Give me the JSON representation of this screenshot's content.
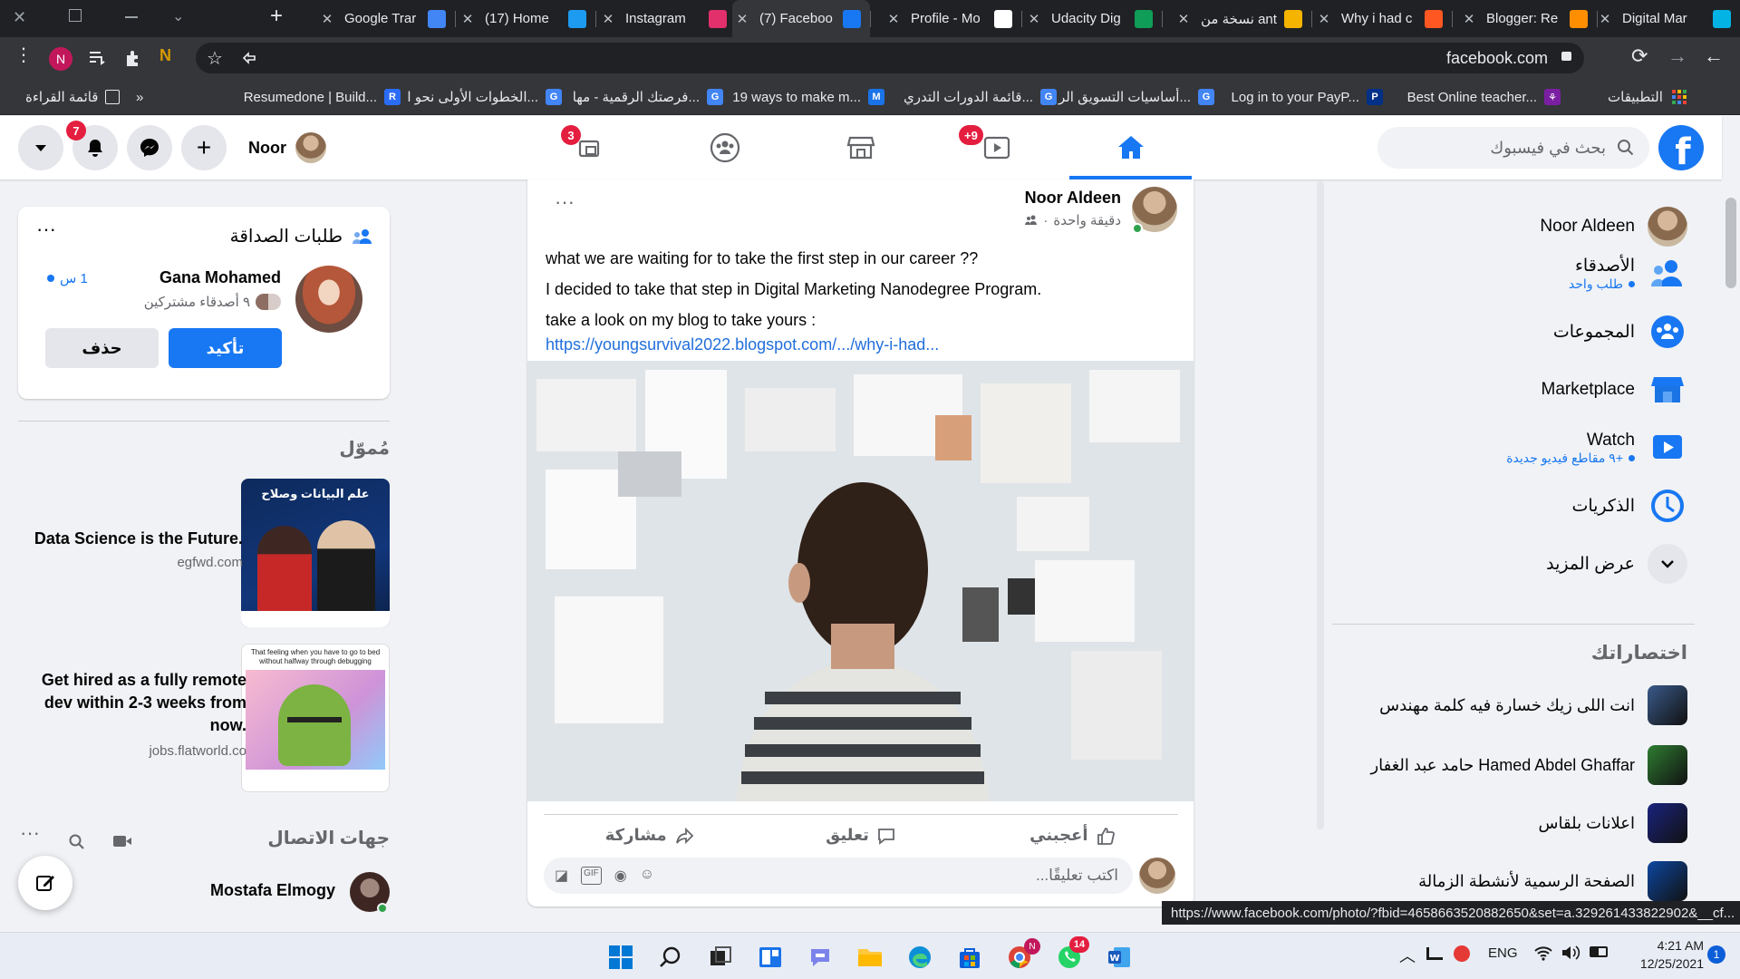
{
  "browser": {
    "tabs": [
      {
        "title": "Google Trar",
        "icon": "google-translate-icon",
        "color": "#4285f4"
      },
      {
        "title": "(17) Home",
        "icon": "twitter-icon",
        "color": "#1d9bf0"
      },
      {
        "title": "Instagram",
        "icon": "instagram-icon",
        "color": "#e1306c"
      },
      {
        "title": "(7) Faceboo",
        "icon": "facebook-icon",
        "color": "#1877f2",
        "active": true
      },
      {
        "title": "Profile - Mo",
        "icon": "document-icon",
        "color": "#ffffff"
      },
      {
        "title": "Udacity Dig",
        "icon": "sheets-icon",
        "color": "#0f9d58"
      },
      {
        "title": "نسخة من ant",
        "icon": "slides-icon",
        "color": "#f4b400"
      },
      {
        "title": "Why i had c",
        "icon": "blogger-icon",
        "color": "#ff5722"
      },
      {
        "title": "Blogger: Re",
        "icon": "blogger-icon",
        "color": "#ff8f00"
      },
      {
        "title": "Digital Mar",
        "icon": "udacity-icon",
        "color": "#02b3e4"
      }
    ],
    "url": "facebook.com",
    "bookmarks": [
      {
        "label": "Resumedone | Build...",
        "icon": "R",
        "color": "#2b6cf6"
      },
      {
        "label": "الخطوات الأولى نحو ا...",
        "icon": "G",
        "color": "#4285f4"
      },
      {
        "label": "فرصتك الرقمية - مها...",
        "icon": "G",
        "color": "#4285f4"
      },
      {
        "label": "19 ways to make m...",
        "icon": "M",
        "color": "#1a73e8"
      },
      {
        "label": "قائمة الدورات التدري...",
        "icon": "G",
        "color": "#4285f4"
      },
      {
        "label": "أساسيات التسويق الر...",
        "icon": "G",
        "color": "#4285f4"
      },
      {
        "label": "Log in to your PayP...",
        "icon": "P",
        "color": "#003087"
      },
      {
        "label": "Best Online teacher...",
        "icon": "⚘",
        "color": "#7b1fa2"
      }
    ],
    "apps_label": "التطبيقات",
    "reading_list": "قائمة القراءة",
    "profile_initial": "N"
  },
  "header": {
    "search_placeholder": "بحث في فيسبوك",
    "user_name": "Noor",
    "notifications_count": "7",
    "gaming_badge": "3",
    "watch_badge": "+9"
  },
  "right_sidebar": {
    "profile_name": "Noor Aldeen",
    "items": [
      {
        "label": "الأصدقاء",
        "sub": "طلب واحد",
        "icon": "friends-icon"
      },
      {
        "label": "المجموعات",
        "sub": "",
        "icon": "groups-icon"
      },
      {
        "label": "Marketplace",
        "sub": "",
        "icon": "marketplace-icon"
      },
      {
        "label": "Watch",
        "sub": "+٩ مقاطع فيديو جديدة",
        "icon": "watch-icon"
      },
      {
        "label": "الذكريات",
        "sub": "",
        "icon": "memories-icon"
      },
      {
        "label": "عرض المزيد",
        "sub": "",
        "icon": "chevron-down-icon"
      }
    ],
    "shortcuts_title": "اختصاراتك",
    "shortcuts": [
      {
        "label": "انت اللى زيك خسارة فيه كلمة مهندس",
        "color": "#3a5a8a"
      },
      {
        "label": "Hamed Abdel Ghaffar حامد عبد الغفار",
        "color": "#2e7d32"
      },
      {
        "label": "اعلانات بلقاس",
        "color": "#1a237e"
      },
      {
        "label": "الصفحة الرسمية لأنشطة الزمالة",
        "color": "#0d47a1"
      }
    ]
  },
  "post": {
    "author": "Noor Aldeen",
    "time": "دقيقة واحدة",
    "lines": [
      "what we are waiting for to take the first step in our career ??",
      "I decided to take that step in Digital Marketing Nanodegree Program.",
      "take a look on my blog to take yours :"
    ],
    "link": "https://youngsurvival2022.blogspot.com/.../why-i-had...",
    "like_label": "أعجبني",
    "comment_label": "تعليق",
    "share_label": "مشاركة",
    "comment_placeholder": "اكتب تعليقًا..."
  },
  "left_panel": {
    "friend_requests_title": "طلبات الصداقة",
    "request": {
      "name": "Gana Mohamed",
      "time": "1 س",
      "mutual": "٩ أصدقاء مشتركين",
      "confirm": "تأكيد",
      "delete": "حذف"
    },
    "sponsored_title": "مُموّل",
    "ads": [
      {
        "title": "Data Science is the Future.",
        "domain": "egfwd.com",
        "image_text": "علم البيانات وصلاح"
      },
      {
        "title": "Get hired as a fully remote dev within 2-3 weeks from now.",
        "domain": "jobs.flatworld.co",
        "image_text": "That feeling when you have to go to bed without halfway through debugging"
      }
    ],
    "contacts_title": "جهات الاتصال",
    "contacts": [
      {
        "name": "Mostafa Elmogy"
      }
    ]
  },
  "status_url": "https://www.facebook.com/photo/?fbid=4658663520882650&set=a.329261433822902&__cf...",
  "taskbar": {
    "lang": "ENG",
    "time": "4:21 AM",
    "date": "12/25/2021",
    "whatsapp_badge": "14",
    "notif_count": "1"
  }
}
